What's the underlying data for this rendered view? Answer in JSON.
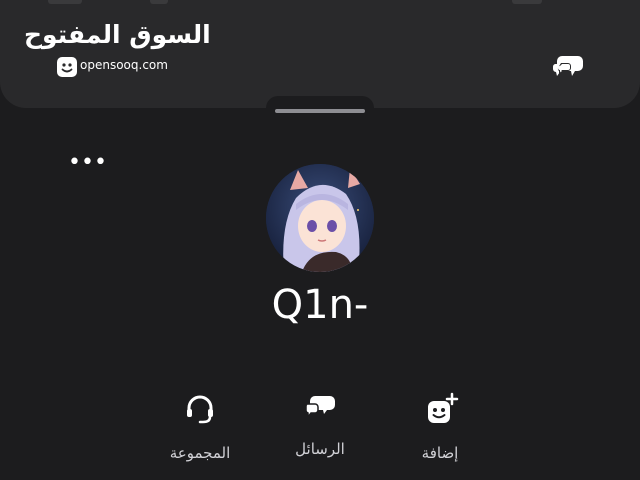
{
  "header": {
    "logo_arabic": "السوق المفتوح",
    "logo_english": "opensooq.com"
  },
  "profile": {
    "more_label": "•••",
    "username": "Q1n-"
  },
  "actions": [
    {
      "label": "المجموعة",
      "icon": "headset-icon"
    },
    {
      "label": "الرسائل",
      "icon": "chat-bubbles-icon"
    },
    {
      "label": "إضافة",
      "icon": "add-friend-icon"
    }
  ],
  "colors": {
    "background": "#1c1c1e",
    "panel": "#29292b",
    "text": "#ffffff",
    "label": "#d1d1d6"
  }
}
